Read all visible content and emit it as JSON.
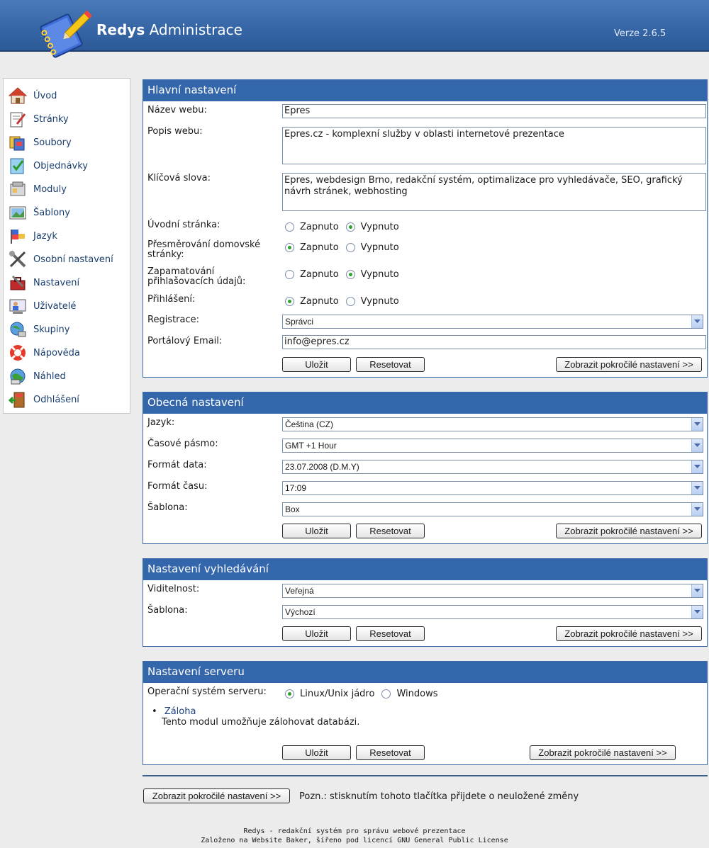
{
  "header": {
    "app_name_bold": "Redys",
    "app_name_rest": "Administrace",
    "version": "Verze 2.6.5"
  },
  "sidebar": {
    "items": [
      {
        "label": "Úvod",
        "icon": "home-icon"
      },
      {
        "label": "Stránky",
        "icon": "pages-icon"
      },
      {
        "label": "Soubory",
        "icon": "files-icon"
      },
      {
        "label": "Objednávky",
        "icon": "orders-icon"
      },
      {
        "label": "Moduly",
        "icon": "modules-icon"
      },
      {
        "label": "Šablony",
        "icon": "templates-icon"
      },
      {
        "label": "Jazyk",
        "icon": "language-icon"
      },
      {
        "label": "Osobní nastavení",
        "icon": "tools-icon"
      },
      {
        "label": "Nastavení",
        "icon": "settings-icon"
      },
      {
        "label": "Uživatelé",
        "icon": "users-icon"
      },
      {
        "label": "Skupiny",
        "icon": "groups-icon"
      },
      {
        "label": "Nápověda",
        "icon": "help-icon"
      },
      {
        "label": "Náhled",
        "icon": "preview-icon"
      },
      {
        "label": "Odhlášení",
        "icon": "logout-icon"
      }
    ]
  },
  "main_settings": {
    "title": "Hlavní nastavení",
    "site_name_label": "Název webu:",
    "site_name_value": "Epres",
    "site_desc_label": "Popis webu:",
    "site_desc_value": "Epres.cz - komplexní služby v oblasti internetové prezentace",
    "keywords_label": "Klíčová slova:",
    "keywords_value": "Epres, webdesign Brno, redakční systém, optimalizace pro vyhledávače, SEO, grafický návrh stránek, webhosting",
    "intro_page_label": "Úvodní stránka:",
    "homepage_redirect_label_1": "Přesměrování domovské",
    "homepage_redirect_label_2": "stránky:",
    "remember_login_label_1": "Zapamatování",
    "remember_login_label_2": "přihlašovacích údajů:",
    "login_label": "Přihlášení:",
    "on_label": "Zapnuto",
    "off_label": "Vypnuto",
    "registration_label": "Registrace:",
    "registration_value": "Správci",
    "email_label": "Portálový Email:",
    "email_value": "info@epres.cz",
    "intro_page_on": false,
    "homepage_redirect_on": true,
    "remember_login_on": false,
    "login_on": true
  },
  "general_settings": {
    "title": "Obecná nastavení",
    "language_label": "Jazyk:",
    "language_value": "Čeština (CZ)",
    "timezone_label": "Časové pásmo:",
    "timezone_value": "GMT +1 Hour",
    "date_format_label": "Formát data:",
    "date_format_value": "23.07.2008 (D.M.Y)",
    "time_format_label": "Formát času:",
    "time_format_value": "17:09",
    "template_label": "Šablona:",
    "template_value": "Box"
  },
  "search_settings": {
    "title": "Nastavení vyhledávání",
    "visibility_label": "Viditelnost:",
    "visibility_value": "Veřejná",
    "template_label": "Šablona:",
    "template_value": "Výchozí"
  },
  "server_settings": {
    "title": "Nastavení serveru",
    "os_label": "Operační systém serveru:",
    "os_linux": "Linux/Unix jádro",
    "os_windows": "Windows",
    "os_selected": "Linux/Unix jádro",
    "backup_link": "Záloha",
    "backup_desc": "Tento modul umožňuje zálohovat databázi."
  },
  "buttons": {
    "save": "Uložit",
    "reset": "Resetovat",
    "advanced": "Zobrazit pokročilé nastavení >>"
  },
  "bottom": {
    "advanced": "Zobrazit pokročilé nastavení >>",
    "note": "Pozn.: stisknutím tohoto tlačítka přijdete o neuložené změny"
  },
  "footer": {
    "line1": "Redys - redakční systém pro správu webové prezentace",
    "line2": "Založeno na Website Baker, šířeno pod licencí GNU General Public License"
  }
}
